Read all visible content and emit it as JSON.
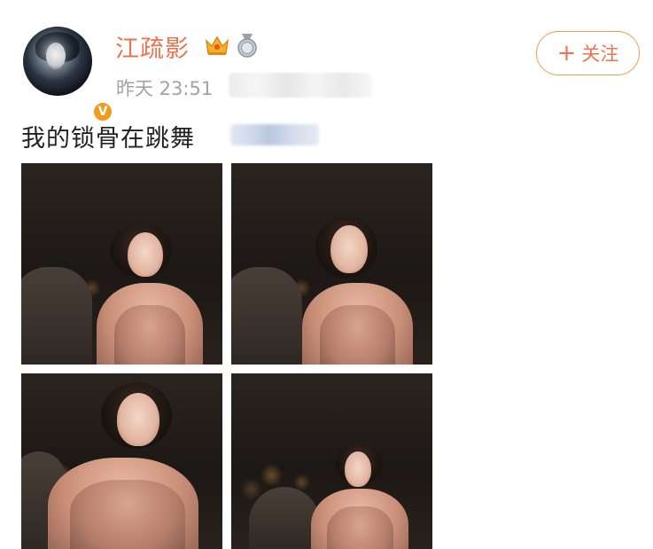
{
  "post": {
    "username": "江疏影",
    "timestamp": "昨天 23:51",
    "verified_badge": "V",
    "follow_label": "关注",
    "follow_icon": "+",
    "text": "我的锁骨在跳舞",
    "icons": {
      "crown": "crown-icon",
      "medal": "medal-icon"
    },
    "colors": {
      "username": "#eb7350",
      "follow_border": "#f29a50",
      "verified": "#f39a1a",
      "meta": "#a3a3a3"
    },
    "photos": [
      {
        "alt": "photo-1"
      },
      {
        "alt": "photo-2"
      },
      {
        "alt": "photo-3"
      },
      {
        "alt": "photo-4"
      }
    ]
  }
}
